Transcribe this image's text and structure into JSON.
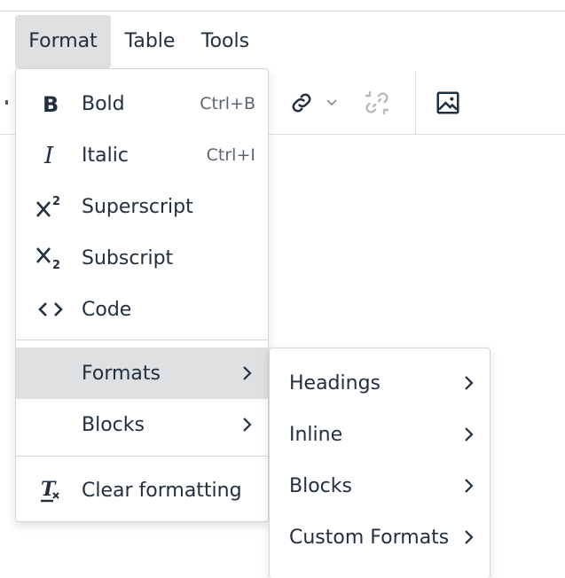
{
  "menubar": {
    "items": [
      "Format",
      "Table",
      "Tools"
    ]
  },
  "toolbar": {
    "buttons": [
      "link-icon",
      "chevron-down-icon",
      "unlink-icon",
      "image-icon"
    ]
  },
  "format_menu": {
    "items": [
      {
        "label": "Bold",
        "shortcut": "Ctrl+B",
        "icon": "bold-icon"
      },
      {
        "label": "Italic",
        "shortcut": "Ctrl+I",
        "icon": "italic-icon"
      },
      {
        "label": "Superscript",
        "icon": "superscript-icon"
      },
      {
        "label": "Subscript",
        "icon": "subscript-icon"
      },
      {
        "label": "Code",
        "icon": "code-icon"
      },
      {
        "label": "Formats",
        "submenu": true,
        "highlighted": true
      },
      {
        "label": "Blocks",
        "submenu": true
      },
      {
        "label": "Clear formatting",
        "icon": "clear-formatting-icon"
      }
    ]
  },
  "formats_submenu": {
    "items": [
      {
        "label": "Headings",
        "submenu": true
      },
      {
        "label": "Inline",
        "submenu": true
      },
      {
        "label": "Blocks",
        "submenu": true
      },
      {
        "label": "Custom Formats",
        "submenu": true
      }
    ]
  },
  "colors": {
    "text": "#222f3e",
    "highlight": "#dee0e2",
    "border": "#d6d6d6"
  }
}
